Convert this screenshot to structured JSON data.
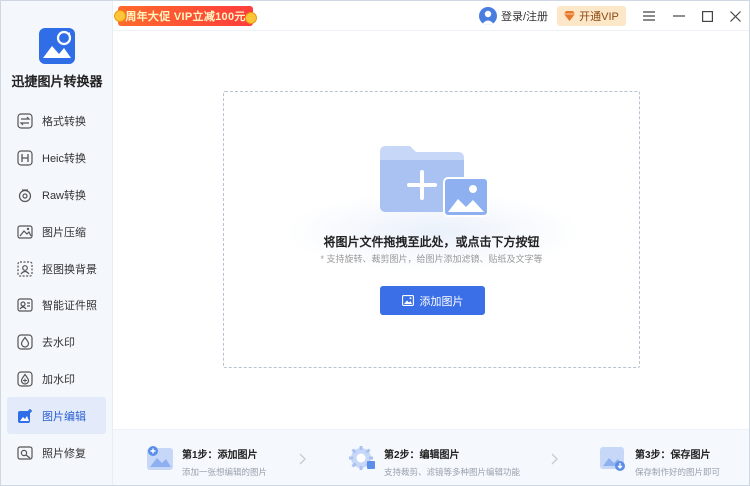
{
  "promo": {
    "text": "周年大促 VIP立减100元"
  },
  "header": {
    "login_label": "登录/注册",
    "vip_label": "开通VIP",
    "menu_icon": "menu-icon",
    "minimize_icon": "minimize-icon",
    "maximize_icon": "maximize-icon",
    "close_icon": "close-icon"
  },
  "app": {
    "title": "迅捷图片转换器"
  },
  "sidebar": {
    "items": [
      {
        "label": "格式转换",
        "icon": "format-convert-icon"
      },
      {
        "label": "Heic转换",
        "icon": "heic-icon"
      },
      {
        "label": "Raw转换",
        "icon": "raw-icon"
      },
      {
        "label": "图片压缩",
        "icon": "compress-icon"
      },
      {
        "label": "抠图换背景",
        "icon": "cutout-icon"
      },
      {
        "label": "智能证件照",
        "icon": "id-photo-icon"
      },
      {
        "label": "去水印",
        "icon": "remove-watermark-icon"
      },
      {
        "label": "加水印",
        "icon": "add-watermark-icon"
      },
      {
        "label": "图片编辑",
        "icon": "image-edit-icon",
        "active": true
      },
      {
        "label": "照片修复",
        "icon": "photo-repair-icon"
      }
    ]
  },
  "dropzone": {
    "title": "将图片文件拖拽至此处，或点击下方按钮",
    "subtitle": "* 支持旋转、裁剪图片，给图片添加滤镜、贴纸及文字等",
    "button_label": "添加图片"
  },
  "steps": [
    {
      "title": "第1步：添加图片",
      "desc": "添加一张想编辑的图片"
    },
    {
      "title": "第2步：编辑图片",
      "desc": "支持裁剪、滤镜等多种图片编辑功能"
    },
    {
      "title": "第3步：保存图片",
      "desc": "保存制作好的图片即可"
    }
  ],
  "colors": {
    "accent": "#3a6fe8",
    "sidebar_bg": "#f4f7fc",
    "active_bg": "#e3ebfb",
    "promo": "#ff4a32",
    "vip_bg": "#fde7c9"
  }
}
